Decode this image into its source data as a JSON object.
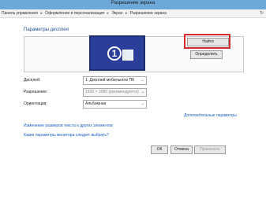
{
  "window": {
    "title": "Разрешение экрана"
  },
  "breadcrumb": {
    "items": [
      "Панель управления",
      "Оформление и персонализация",
      "Экран",
      "Разрешение экрана"
    ],
    "separator": "▸",
    "refresh_icon": "↻"
  },
  "display_section": {
    "heading": "Параметры дисплея",
    "monitor_number": "1",
    "find_button": "Найти",
    "detect_button": "Определить"
  },
  "settings": {
    "display_label": "Дисплей:",
    "display_value": "1. Дисплей мобильного ПК",
    "resolution_label": "Разрешение:",
    "resolution_value": "1920 × 1080 (рекомендуется)",
    "orientation_label": "Ориентация:",
    "orientation_value": "Альбомная",
    "dropdown_arrow": "⌄"
  },
  "links": {
    "advanced": "Дополнительные параметры",
    "text_size": "Изменение размеров текста и других элементов",
    "which_settings": "Какие параметры монитора следует выбрать?"
  },
  "buttons": {
    "ok": "ОК",
    "cancel": "Отмена",
    "apply": "Применить"
  },
  "colors": {
    "highlight_frame": "#d12d2d",
    "monitor_fill": "#2b3f9a",
    "link": "#1b5fbf"
  }
}
